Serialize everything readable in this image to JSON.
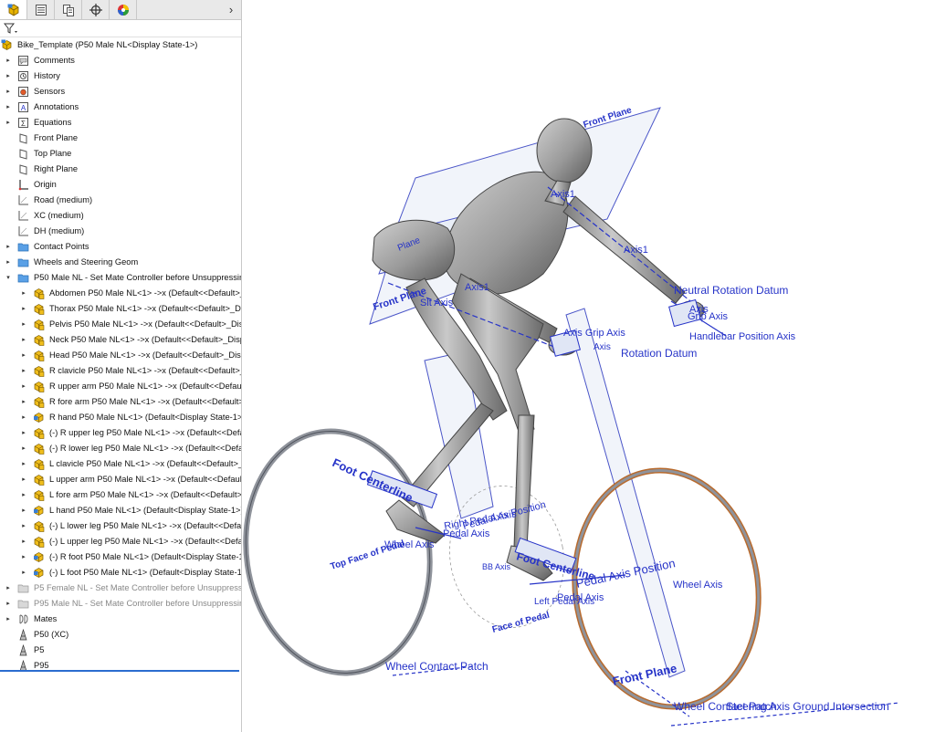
{
  "tree": {
    "root": "Bike_Template  (P50 Male NL<Display State-1>)",
    "top": [
      {
        "label": "Comments",
        "icon": "comments-icon",
        "exp": true
      },
      {
        "label": "History",
        "icon": "history-icon",
        "exp": true
      },
      {
        "label": "Sensors",
        "icon": "sensors-icon",
        "exp": true
      },
      {
        "label": "Annotations",
        "icon": "annotations-icon",
        "exp": true
      },
      {
        "label": "Equations",
        "icon": "equations-icon",
        "exp": true
      },
      {
        "label": "Front Plane",
        "icon": "plane-icon",
        "exp": false
      },
      {
        "label": "Top Plane",
        "icon": "plane-icon",
        "exp": false
      },
      {
        "label": "Right Plane",
        "icon": "plane-icon",
        "exp": false
      },
      {
        "label": "Origin",
        "icon": "origin-icon",
        "exp": false
      },
      {
        "label": "Road (medium)",
        "icon": "sketch-icon",
        "exp": false
      },
      {
        "label": "XC (medium)",
        "icon": "sketch-icon",
        "exp": false
      },
      {
        "label": "DH (medium)",
        "icon": "sketch-icon",
        "exp": false
      },
      {
        "label": "Contact Points",
        "icon": "folder-icon",
        "exp": true
      },
      {
        "label": "Wheels and Steering Geom",
        "icon": "folder-icon",
        "exp": true
      }
    ],
    "open_folder": "P50 Male NL - Set Mate Controller before Unsuppressing",
    "children": [
      {
        "label": "Abdomen P50 Male NL<1> ->x (Default<<Default>_Disp",
        "icon": "subassembly-icon"
      },
      {
        "label": "Thorax P50 Male NL<1> ->x (Default<<Default>_Disp",
        "icon": "subassembly-icon"
      },
      {
        "label": "Pelvis P50 Male NL<1> ->x (Default<<Default>_Disp",
        "icon": "subassembly-icon"
      },
      {
        "label": "Neck P50 Male NL<1> ->x (Default<<Default>_Disp",
        "icon": "subassembly-icon"
      },
      {
        "label": "Head P50 Male NL<1> ->x (Default<<Default>_Disp",
        "icon": "subassembly-icon"
      },
      {
        "label": "R clavicle P50 Male NL<1> ->x (Default<<Default>_",
        "icon": "subassembly-icon"
      },
      {
        "label": "R upper arm P50 Male NL<1> ->x (Default<<Default",
        "icon": "subassembly-icon"
      },
      {
        "label": "R fore arm P50 Male NL<1> ->x (Default<<Default>",
        "icon": "subassembly-icon"
      },
      {
        "label": "R hand P50 Male NL<1> (Default<Display State-1>)",
        "icon": "part-icon"
      },
      {
        "label": "(-) R upper leg P50 Male NL<1> ->x (Default<<Defa",
        "icon": "subassembly-icon"
      },
      {
        "label": "(-) R lower leg P50 Male NL<1> ->x (Default<<Defa",
        "icon": "subassembly-icon"
      },
      {
        "label": "L clavicle P50 Male NL<1> ->x (Default<<Default>_",
        "icon": "subassembly-icon"
      },
      {
        "label": "L upper arm P50 Male NL<1> ->x (Default<<Default",
        "icon": "subassembly-icon"
      },
      {
        "label": "L fore arm P50 Male NL<1> ->x (Default<<Default>",
        "icon": "subassembly-icon"
      },
      {
        "label": "L hand P50 Male NL<1> (Default<Display State-1>)",
        "icon": "part-icon"
      },
      {
        "label": "(-) L lower leg P50 Male NL<1> ->x (Default<<Defa",
        "icon": "subassembly-icon"
      },
      {
        "label": "(-) L upper leg P50 Male NL<1> ->x (Default<<Defa",
        "icon": "subassembly-icon"
      },
      {
        "label": "(-) R foot P50 Male NL<1> (Default<Display State-1",
        "icon": "part-icon"
      },
      {
        "label": "(-) L foot P50 Male NL<1> (Default<Display State-1",
        "icon": "part-icon"
      }
    ],
    "after": [
      {
        "label": "P5 Female NL - Set Mate Controller before Unsuppressing",
        "icon": "folder-gray-icon",
        "exp": true,
        "dim": true
      },
      {
        "label": "P95 Male NL - Set Mate Controller before Unsuppressing",
        "icon": "folder-gray-icon",
        "exp": true,
        "dim": true
      },
      {
        "label": "Mates",
        "icon": "mates-icon",
        "exp": true,
        "dim": false
      },
      {
        "label": "P50 (XC)",
        "icon": "config-icon",
        "exp": false,
        "dim": false
      },
      {
        "label": "P5",
        "icon": "config-icon",
        "exp": false,
        "dim": false
      },
      {
        "label": "P95",
        "icon": "config-icon",
        "exp": false,
        "dim": false
      }
    ]
  },
  "viewport": {
    "labels": [
      "Front Plane",
      "Axis1",
      "Axis1",
      "Plane",
      "Front Plane",
      "Slt Axis",
      "Axis1",
      "Neutral Rotation Datum",
      "Axis",
      "Grip Axis",
      "Handlebar Position Axis",
      "Axis Grip Axis",
      "Axis",
      "Rotation Datum",
      "Foot Centerline",
      "Right Pedal Axis",
      "Pedal Axis",
      "Pedal Axis Position",
      "Wheel Axis",
      "Top Face of Pedal",
      "BB Axis",
      "Foot Centerline",
      "Pedal Axis Position",
      "Wheel Axis",
      "Pedal Axis",
      "Left Pedal Axis",
      "Face of Pedal",
      "Wheel Contact Patch",
      "Front Plane",
      "Wheel Contact Patch",
      "Steering Axis Ground Intersection"
    ]
  }
}
